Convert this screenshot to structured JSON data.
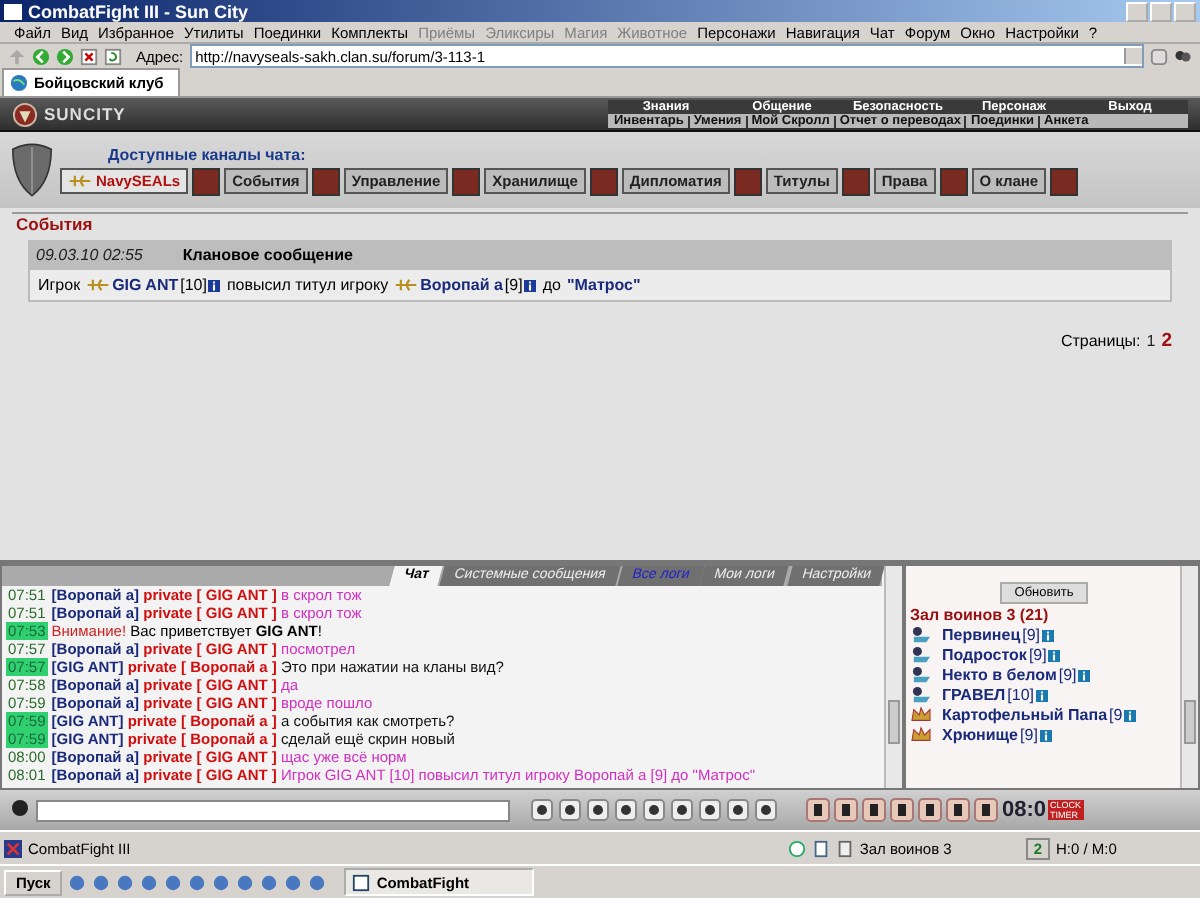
{
  "window": {
    "title": "CombatFight III - Sun City"
  },
  "menu": [
    {
      "label": "Файл",
      "disabled": false
    },
    {
      "label": "Вид",
      "disabled": false
    },
    {
      "label": "Избранное",
      "disabled": false
    },
    {
      "label": "Утилиты",
      "disabled": false
    },
    {
      "label": "Поединки",
      "disabled": false
    },
    {
      "label": "Комплекты",
      "disabled": false
    },
    {
      "label": "Приёмы",
      "disabled": true
    },
    {
      "label": "Эликсиры",
      "disabled": true
    },
    {
      "label": "Магия",
      "disabled": true
    },
    {
      "label": "Животное",
      "disabled": true
    },
    {
      "label": "Персонажи",
      "disabled": false
    },
    {
      "label": "Навигация",
      "disabled": false
    },
    {
      "label": "Чат",
      "disabled": false
    },
    {
      "label": "Форум",
      "disabled": false
    },
    {
      "label": "Окно",
      "disabled": false
    },
    {
      "label": "Настройки",
      "disabled": false
    },
    {
      "label": "?",
      "disabled": false
    }
  ],
  "address": {
    "label": "Адрес:",
    "value": "http://navyseals-sakh.clan.su/forum/3-113-1"
  },
  "browser_tab": {
    "label": "Бойцовский клуб"
  },
  "game_header": {
    "logo": "SUNCITY",
    "nav_top": [
      "Знания",
      "Общение",
      "Безопасность",
      "Персонаж",
      "Выход"
    ],
    "nav_bottom": [
      "Инвентарь",
      "Умения",
      "Мой Скролл",
      "Отчет о переводах",
      "Поединки",
      "Анкета"
    ]
  },
  "channels": {
    "title": "Доступные каналы чата:",
    "items": [
      {
        "label": "NavySEALs",
        "selected": true
      },
      {
        "label": "События",
        "selected": false
      },
      {
        "label": "Управление",
        "selected": false
      },
      {
        "label": "Хранилище",
        "selected": false
      },
      {
        "label": "Дипломатия",
        "selected": false
      },
      {
        "label": "Титулы",
        "selected": false
      },
      {
        "label": "Права",
        "selected": false
      },
      {
        "label": "О клане",
        "selected": false
      }
    ]
  },
  "events": {
    "title": "События",
    "entries": [
      {
        "date": "09.03.10 02:55",
        "heading": "Клановое сообщение",
        "parts": [
          {
            "kind": "text",
            "text": "Игрок"
          },
          {
            "kind": "player",
            "name": "GIG ANT",
            "level": "[10]"
          },
          {
            "kind": "text",
            "text": "повысил титул игроку"
          },
          {
            "kind": "player",
            "name": "Воропай а",
            "level": "[9]"
          },
          {
            "kind": "text",
            "text": "до"
          },
          {
            "kind": "title",
            "text": "\"Матрос\""
          }
        ]
      }
    ],
    "pages_label": "Страницы:",
    "pages": [
      {
        "label": "1",
        "selected": false
      },
      {
        "label": "2",
        "selected": true
      }
    ]
  },
  "chat": {
    "tabs": [
      {
        "label": "Чат",
        "selected": true,
        "highlighted": false
      },
      {
        "label": "Системные сообщения",
        "selected": false,
        "highlighted": false
      },
      {
        "label": "Все логи",
        "selected": false,
        "highlighted": true
      },
      {
        "label": "Мои логи",
        "selected": false,
        "highlighted": false
      },
      {
        "label": "Настройки",
        "selected": false,
        "highlighted": false
      }
    ],
    "lines": [
      {
        "kind": "private",
        "time": "07:51",
        "highlighted": false,
        "from": "[Воропай а]",
        "to": "private [ GIG ANT ]",
        "text": "в скрол тож"
      },
      {
        "kind": "private",
        "time": "07:51",
        "highlighted": false,
        "from": "[Воропай а]",
        "to": "private [ GIG ANT ]",
        "text": "в скрол тож"
      },
      {
        "kind": "system",
        "time": "07:53",
        "highlighted": true,
        "label": "Внимание!",
        "text": "Вас приветствует **GIG ANT**!"
      },
      {
        "kind": "private",
        "time": "07:57",
        "highlighted": false,
        "from": "[Воропай а]",
        "to": "private [ GIG ANT ]",
        "text": "посмотрел"
      },
      {
        "kind": "private",
        "time": "07:57",
        "highlighted": true,
        "from": "[GIG ANT]",
        "to": "private [ Воропай а ]",
        "text": "Это при нажатии на кланы вид?"
      },
      {
        "kind": "private",
        "time": "07:58",
        "highlighted": false,
        "from": "[Воропай а]",
        "to": "private [ GIG ANT ]",
        "text": "да"
      },
      {
        "kind": "private",
        "time": "07:59",
        "highlighted": false,
        "from": "[Воропай а]",
        "to": "private [ GIG ANT ]",
        "text": "вроде пошло"
      },
      {
        "kind": "private",
        "time": "07:59",
        "highlighted": true,
        "from": "[GIG ANT]",
        "to": "private [ Воропай а ]",
        "text": "а события как смотреть?"
      },
      {
        "kind": "private",
        "time": "07:59",
        "highlighted": true,
        "from": "[GIG ANT]",
        "to": "private [ Воропай а ]",
        "text": "сделай ещё скрин новый"
      },
      {
        "kind": "private",
        "time": "08:00",
        "highlighted": false,
        "from": "[Воропай а]",
        "to": "private [ GIG ANT ]",
        "text": "щас уже всё норм"
      },
      {
        "kind": "private",
        "time": "08:01",
        "highlighted": false,
        "from": "[Воропай а]",
        "to": "private [ GIG ANT ]",
        "text": "Игрок GIG ANT [10] повысил титул игроку Воропай а [9] до \"Матрос\""
      }
    ]
  },
  "room": {
    "refresh": "Обновить",
    "title": "Зал воинов 3 (21)",
    "players": [
      {
        "kind": "clan",
        "name": "Первинец",
        "level": "[9]"
      },
      {
        "kind": "clan",
        "name": "Подросток",
        "level": "[9]"
      },
      {
        "kind": "clan",
        "name": "Некто в белом",
        "level": "[9]"
      },
      {
        "kind": "clan",
        "name": "ГРАВЕЛ",
        "level": "[10]"
      },
      {
        "kind": "crown",
        "name": "Картофельный Папа",
        "level": "[9"
      },
      {
        "kind": "crown",
        "name": "Хрюнище",
        "level": "[9]"
      }
    ]
  },
  "clock": {
    "time": "08:0",
    "labels": [
      "CLOCK",
      "TIMER"
    ]
  },
  "status_bar": {
    "app": "CombatFight III",
    "room": "Зал воинов 3",
    "count": "2",
    "hp": "H:0 / M:0"
  },
  "taskbar": {
    "start": "Пуск",
    "window": "CombatFight"
  }
}
